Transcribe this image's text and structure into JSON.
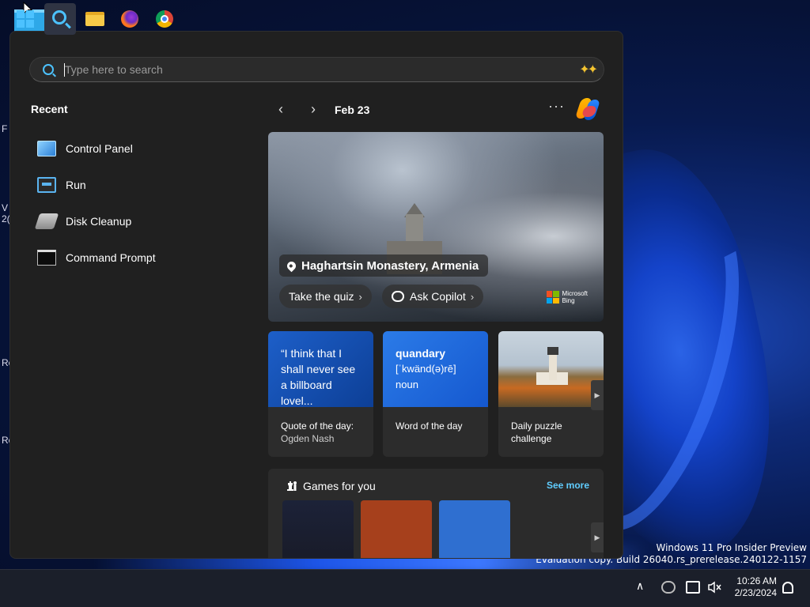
{
  "desktop": {
    "watermark_line1": "Windows 11 Pro Insider Preview",
    "watermark_line2": "Evaluation copy. Build 26040.rs_prerelease.240122-1157",
    "clipped_labels": [
      "F",
      "V",
      "2(",
      "Ro",
      "Ro"
    ]
  },
  "search": {
    "placeholder": "Type here to search",
    "value": ""
  },
  "recent": {
    "title": "Recent",
    "items": [
      {
        "label": "Control Panel",
        "icon": "control-panel-icon"
      },
      {
        "label": "Run",
        "icon": "run-icon"
      },
      {
        "label": "Disk Cleanup",
        "icon": "disk-cleanup-icon"
      },
      {
        "label": "Command Prompt",
        "icon": "command-prompt-icon"
      }
    ]
  },
  "feed": {
    "date": "Feb 23",
    "hero": {
      "location": "Haghartsin Monastery, Armenia",
      "quiz_label": "Take the quiz",
      "copilot_label": "Ask Copilot",
      "bing_line1": "Microsoft",
      "bing_line2": "Bing"
    },
    "cards": {
      "quote": {
        "text": "“I think that I shall never see a billboard lovel...",
        "title": "Quote of the day:",
        "subtitle": "Ogden Nash"
      },
      "word": {
        "word": "quandary",
        "pronunciation": "[ˈkwänd(ə)rē]",
        "part_of_speech": "noun",
        "title": "Word of the day"
      },
      "puzzle": {
        "title_line1": "Daily puzzle",
        "title_line2": "challenge"
      }
    },
    "games": {
      "title": "Games for you",
      "see_more": "See more"
    }
  },
  "taskbar": {
    "apps": [
      "start-button",
      "search-button",
      "file-explorer",
      "firefox",
      "chrome"
    ],
    "time": "10:26 AM",
    "date": "2/23/2024"
  },
  "colors": {
    "accent": "#4cc2ff",
    "link": "#60cdff",
    "panel_bg": "#202020"
  }
}
